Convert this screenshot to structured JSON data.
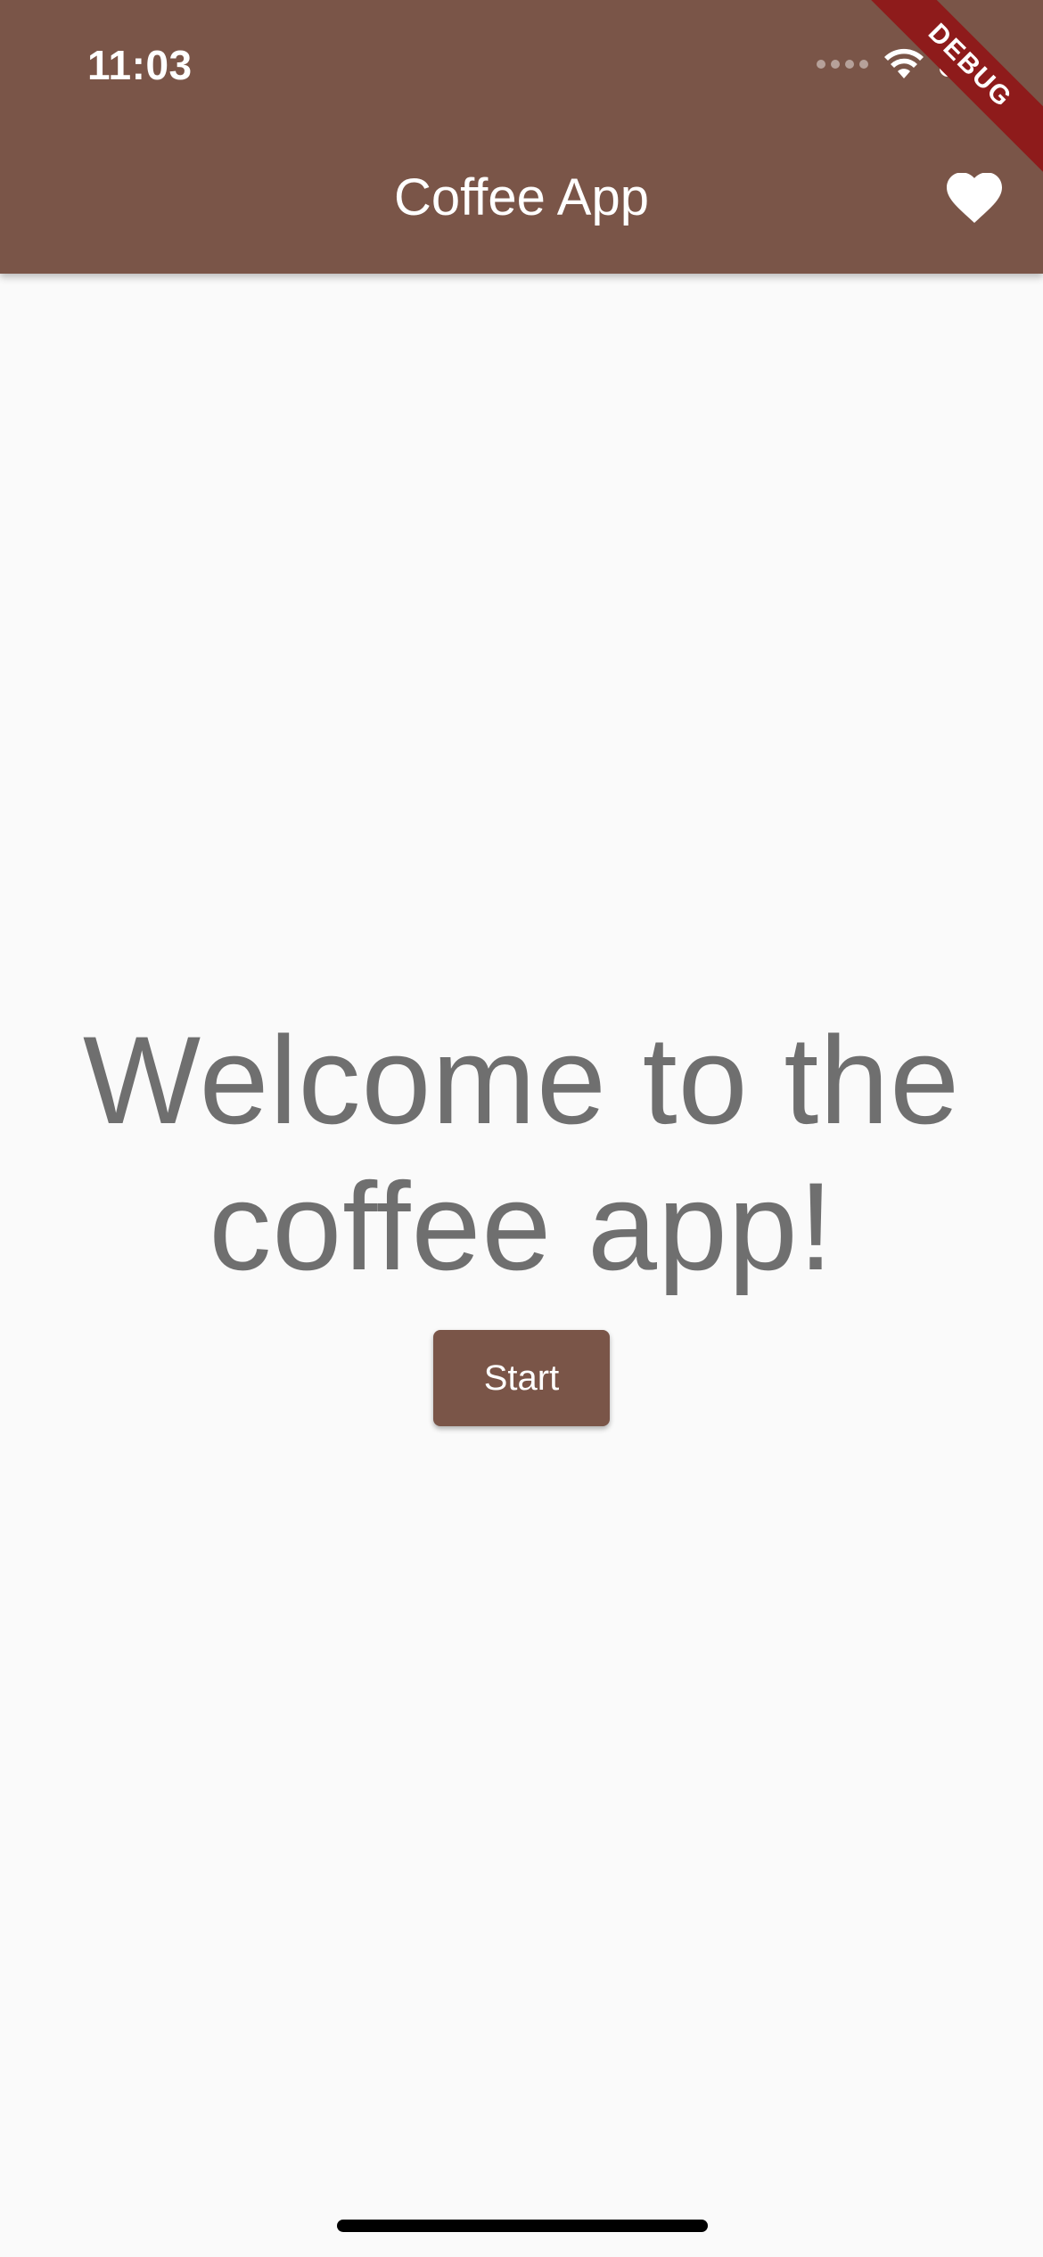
{
  "status_bar": {
    "time": "11:03"
  },
  "app_bar": {
    "title": "Coffee App",
    "favorite_icon": "heart-icon",
    "background_color": "#7a5548"
  },
  "debug_banner": {
    "label": "DEBUG",
    "color": "#8e1b1b"
  },
  "main": {
    "welcome_text": "Welcome to the coffee app!",
    "start_button_label": "Start",
    "text_color": "#6f6f6f"
  }
}
